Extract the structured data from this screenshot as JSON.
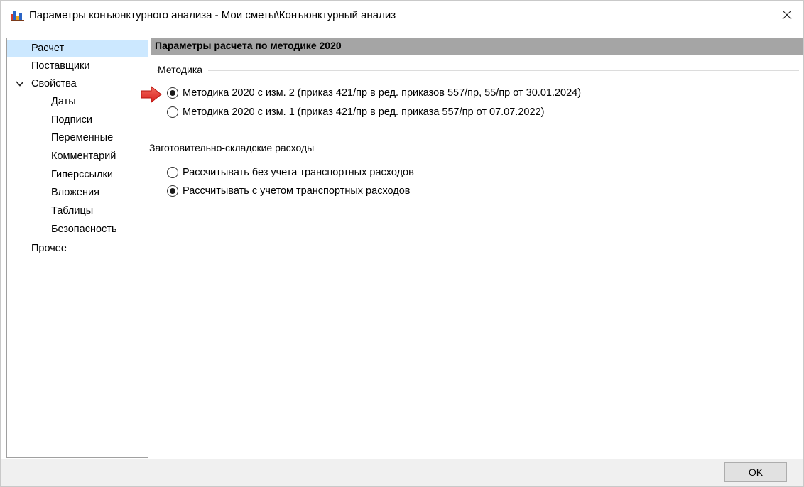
{
  "window": {
    "title": "Параметры конъюнктурного анализа - Мои сметы\\Конъюнктурный анализ"
  },
  "sidebar": {
    "items": [
      {
        "label": "Расчет",
        "selected": true
      },
      {
        "label": "Поставщики"
      },
      {
        "label": "Свойства",
        "expanded": true
      },
      {
        "label": "Даты"
      },
      {
        "label": "Подписи"
      },
      {
        "label": "Переменные"
      },
      {
        "label": "Комментарий"
      },
      {
        "label": "Гиперссылки"
      },
      {
        "label": "Вложения"
      },
      {
        "label": "Таблицы"
      },
      {
        "label": "Безопасность"
      },
      {
        "label": "Прочее"
      }
    ]
  },
  "content": {
    "header": "Параметры расчета по методике 2020",
    "methodology": {
      "title": "Методика",
      "options": [
        {
          "label": "Методика 2020 с изм. 2 (приказ 421/пр в ред. приказов 557/пр, 55/пр от 30.01.2024)",
          "checked": true
        },
        {
          "label": "Методика 2020 с изм. 1 (приказ 421/пр в ред. приказа 557/пр от 07.07.2022)",
          "checked": false
        }
      ]
    },
    "storage_costs": {
      "title": "Заготовительно-складские расходы",
      "options": [
        {
          "label": "Рассчитывать без учета транспортных расходов",
          "checked": false
        },
        {
          "label": "Рассчитывать с учетом транспортных расходов",
          "checked": true
        }
      ]
    }
  },
  "footer": {
    "ok_label": "OK"
  },
  "colors": {
    "selection": "#cce8ff",
    "header_bar": "#a5a5a5",
    "arrow": "#e8312f"
  }
}
